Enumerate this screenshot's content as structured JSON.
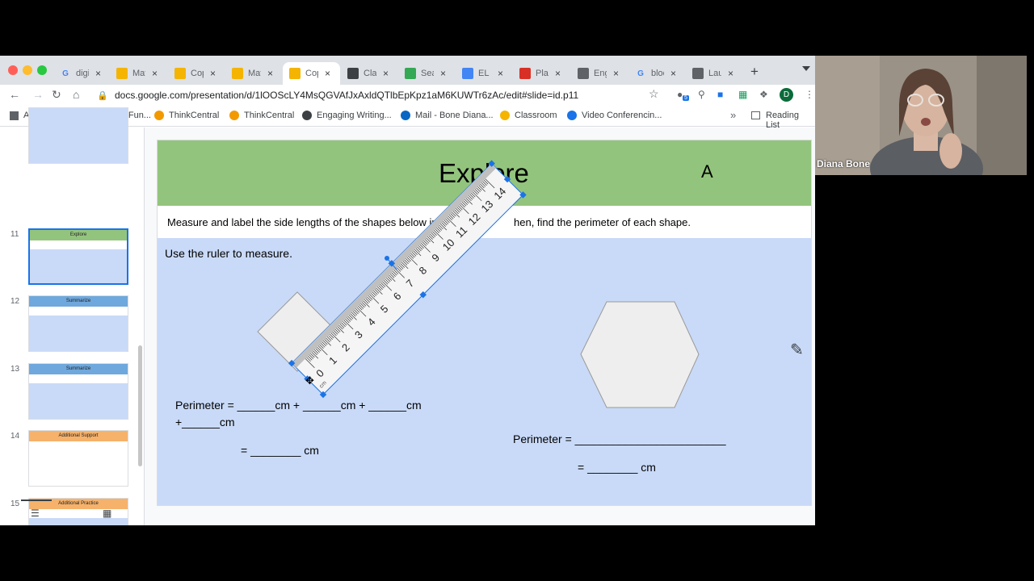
{
  "tabs": [
    {
      "title": "digi",
      "fav": "G",
      "favColor": "#4285f4",
      "favBg": "transparent"
    },
    {
      "title": "Mat",
      "fav": "",
      "favColor": "#fff",
      "favBg": "#f4b400"
    },
    {
      "title": "Cop",
      "fav": "",
      "favColor": "#fff",
      "favBg": "#f4b400"
    },
    {
      "title": "Mat",
      "fav": "",
      "favColor": "#fff",
      "favBg": "#f4b400"
    },
    {
      "title": "Cop",
      "fav": "",
      "favColor": "#fff",
      "favBg": "#f4b400"
    },
    {
      "title": "Clas",
      "fav": "",
      "favColor": "#fff",
      "favBg": "#3c4043"
    },
    {
      "title": "Sea",
      "fav": "",
      "favColor": "#fff",
      "favBg": "#34a853"
    },
    {
      "title": "EL V",
      "fav": "",
      "favColor": "#fff",
      "favBg": "#4285f4"
    },
    {
      "title": "Plan",
      "fav": "",
      "favColor": "#fff",
      "favBg": "#d93025"
    },
    {
      "title": "Eng",
      "fav": "",
      "favColor": "#fff",
      "favBg": "#5f6368"
    },
    {
      "title": "bloc",
      "fav": "G",
      "favColor": "#4285f4",
      "favBg": "transparent"
    },
    {
      "title": "Lau",
      "fav": "",
      "favColor": "#fff",
      "favBg": "#5f6368"
    }
  ],
  "new_tab": "+",
  "url": "docs.google.com/presentation/d/1lOOScLY4MsQGVAfJxAxldQTlbEpKpz1aM6KUWTr6zAc/edit#slide=id.p11",
  "bookmarks": [
    {
      "label": "Apps",
      "color": "#5f6368"
    },
    {
      "label": "Toy Theater | Fun...",
      "color": "#8e6d3b"
    },
    {
      "label": "ThinkCentral",
      "color": "#f29900"
    },
    {
      "label": "ThinkCentral",
      "color": "#f29900"
    },
    {
      "label": "Engaging Writing...",
      "color": "#3c4043"
    },
    {
      "label": "Mail - Bone Diana...",
      "color": "#0a66c2"
    },
    {
      "label": "Classroom",
      "color": "#f4b400"
    },
    {
      "label": "Video Conferencin...",
      "color": "#1a73e8"
    }
  ],
  "bookmarks_overflow": "»",
  "reading_list": "Reading List",
  "profile_initial": "D",
  "extension_badge": "5",
  "slides": [
    {
      "num": "11",
      "title": "Explore"
    },
    {
      "num": "12",
      "title": "Summarize"
    },
    {
      "num": "13",
      "title": "Summarize"
    },
    {
      "num": "14",
      "title": "Additional Support"
    },
    {
      "num": "15",
      "title": "Additional Practice"
    }
  ],
  "slide": {
    "title": "Explore",
    "letter": "A",
    "instruction_left": "Measure and label the side lengths of the shapes below in",
    "instruction_right": "hen, find the perimeter of each shape.",
    "ruler_hint": "Use the ruler to measure.",
    "perimeter_left_line1": "Perimeter = ______cm + ______cm + ______cm",
    "perimeter_left_line2": "+______cm",
    "perimeter_left_eq": "= ________ cm",
    "perimeter_right_line1": "Perimeter = ________________________",
    "perimeter_right_eq": "= ________ cm"
  },
  "ruler_ticks": [
    "0",
    "1",
    "2",
    "3",
    "4",
    "5",
    "6",
    "7",
    "8",
    "9",
    "10",
    "11",
    "12",
    "13",
    "14"
  ],
  "ruler_unit": "cm",
  "webcam_name": "Diana Bone"
}
